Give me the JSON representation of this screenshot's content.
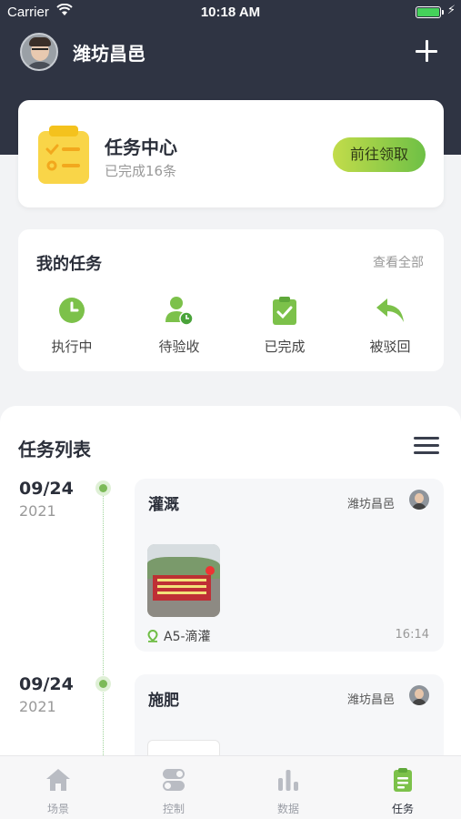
{
  "status_bar": {
    "carrier": "Carrier",
    "time": "10:18 AM"
  },
  "header": {
    "user_name": "潍坊昌邑"
  },
  "task_center": {
    "title": "任务中心",
    "subtitle": "已完成16条",
    "button": "前往领取"
  },
  "my_tasks": {
    "title": "我的任务",
    "view_all": "查看全部",
    "items": [
      {
        "label": "执行中",
        "icon": "clock-icon"
      },
      {
        "label": "待验收",
        "icon": "user-pending-icon"
      },
      {
        "label": "已完成",
        "icon": "clipboard-check-icon"
      },
      {
        "label": "被驳回",
        "icon": "reply-arrow-icon"
      }
    ]
  },
  "task_list": {
    "title": "任务列表",
    "entries": [
      {
        "date": "09/24",
        "year": "2021",
        "title": "灌溉",
        "owner": "潍坊昌邑",
        "location": "A5-滴灌",
        "time": "16:14"
      },
      {
        "date": "09/24",
        "year": "2021",
        "title": "施肥",
        "owner": "潍坊昌邑"
      }
    ]
  },
  "tabbar": {
    "tabs": [
      {
        "label": "场景",
        "icon": "home-icon"
      },
      {
        "label": "控制",
        "icon": "toggle-icon"
      },
      {
        "label": "数据",
        "icon": "bar-chart-icon"
      },
      {
        "label": "任务",
        "icon": "task-list-icon",
        "active": true
      }
    ]
  },
  "colors": {
    "header_bg": "#2f3443",
    "accent_green": "#6ec046"
  }
}
